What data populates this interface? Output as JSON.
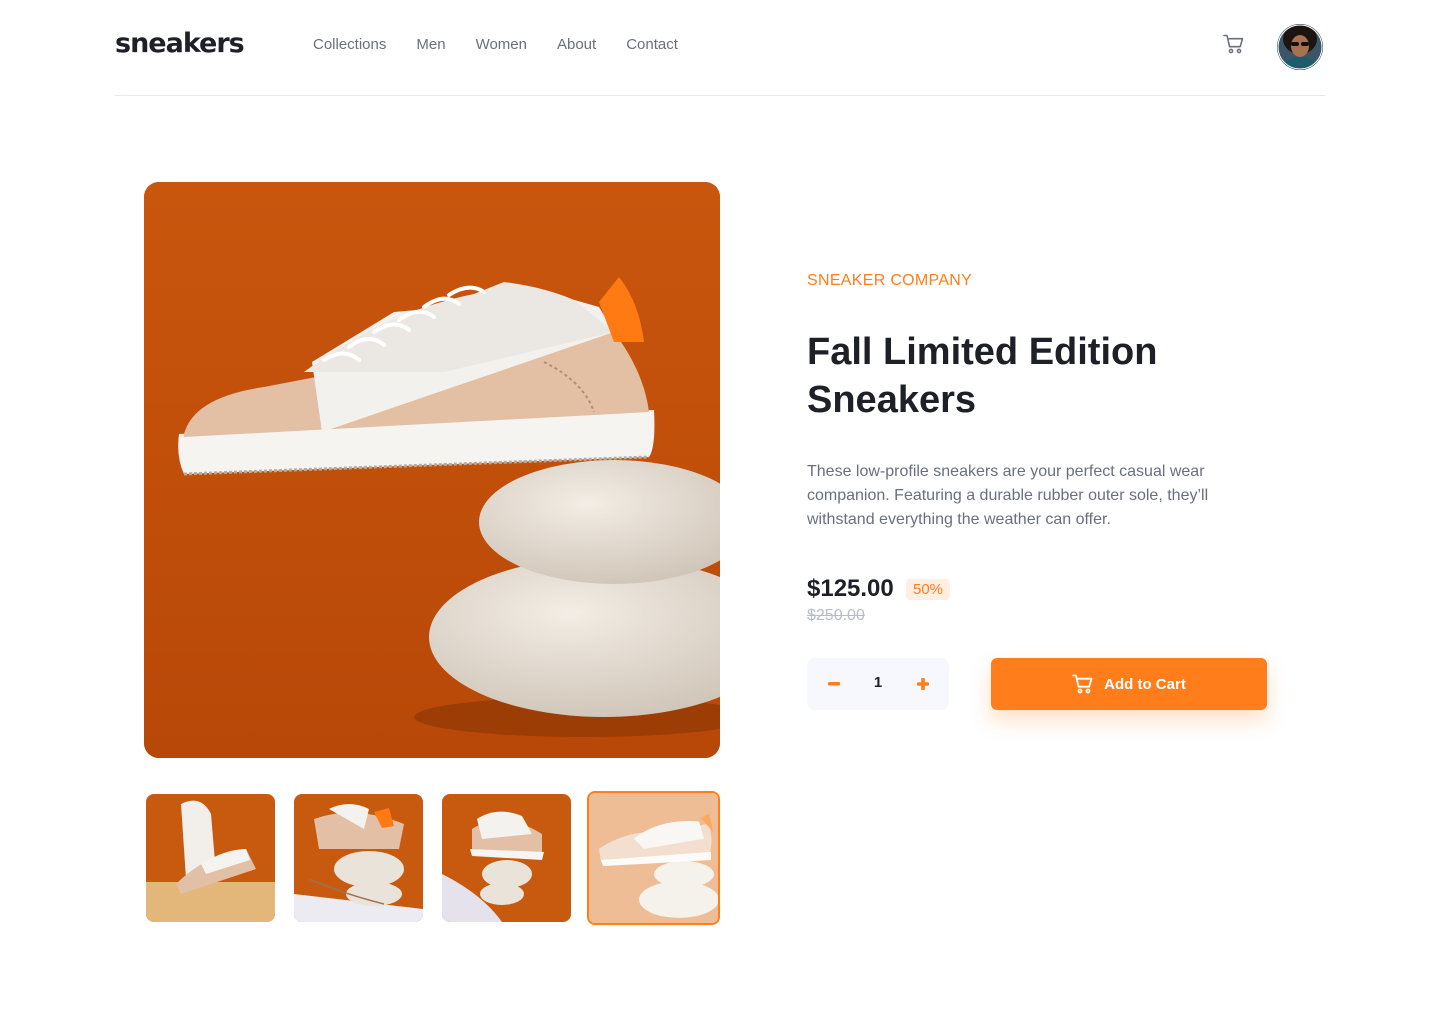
{
  "header": {
    "logo": "sneakers",
    "nav": [
      "Collections",
      "Men",
      "Women",
      "About",
      "Contact"
    ],
    "cart_icon": "cart-icon",
    "avatar_icon": "user-avatar"
  },
  "product": {
    "company": "SNEAKER COMPANY",
    "title": "Fall Limited Edition Sneakers",
    "description": "These low-profile sneakers are your perfect casual wear companion. Featuring a durable rubber outer sole, they’ll withstand everything the weather can offer.",
    "price": "$125.00",
    "discount": "50%",
    "original_price": "$250.00",
    "quantity": "1",
    "add_to_cart_label": "Add to Cart"
  },
  "gallery": {
    "thumbnail_count": 4,
    "active_thumbnail": 4
  },
  "colors": {
    "accent": "#ff7e1b",
    "accent_pale": "#ffeee2",
    "text_dark": "#1d2026",
    "text_muted": "#69707d",
    "text_light": "#b6bcc8",
    "qty_bg": "#f7f8fd",
    "image_bg": "#c8590e"
  }
}
